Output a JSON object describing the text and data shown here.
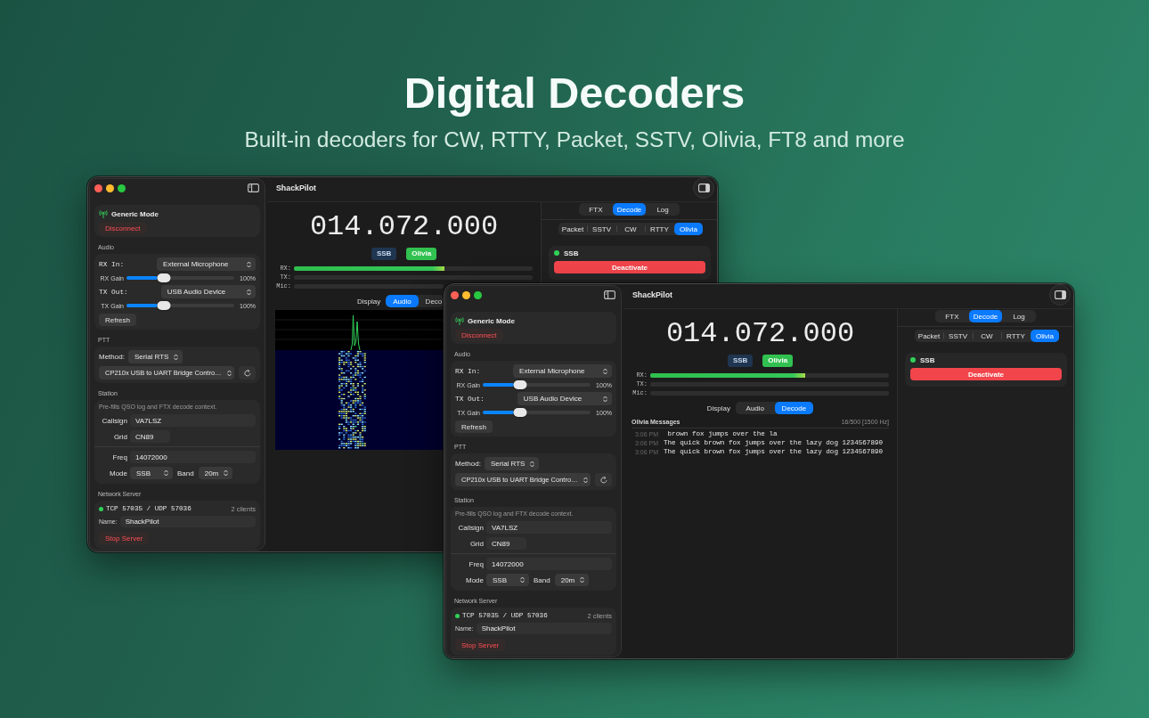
{
  "hero": {
    "title": "Digital Decoders",
    "subtitle": "Built-in decoders for CW, RTTY, Packet, SSTV, Olivia, FT8 and more"
  },
  "windows": [
    {
      "title": "ShackPilot",
      "sidebar": {
        "connection": {
          "mode": "Generic Mode",
          "button": "Disconnect"
        },
        "audio": {
          "heading": "Audio",
          "rows": [
            {
              "kind": "popup",
              "label": "RX In:",
              "value": "External Microphone"
            },
            {
              "kind": "slider",
              "label": "RX Gain",
              "level": 0.35,
              "reading": "100%"
            },
            {
              "kind": "popup",
              "label": "TX Out:",
              "value": "USB Audio Device"
            },
            {
              "kind": "slider",
              "label": "TX Gain",
              "level": 0.35,
              "reading": "100%"
            }
          ],
          "button": "Refresh"
        },
        "ptt": {
          "heading": "PTT",
          "method_label": "Method:",
          "method": "Serial RTS",
          "port": "CP210x USB to UART Bridge Contro…"
        },
        "station": {
          "heading": "Station",
          "note": "Pre-fills QSO log and FTX decode context.",
          "fields": [
            {
              "label": "Callsign",
              "value": "VA7LSZ"
            },
            {
              "label": "Grid",
              "value": "CN89"
            },
            {
              "label": "Freq",
              "value": "14072000"
            }
          ],
          "selects": [
            {
              "label": "Mode",
              "value": "SSB"
            },
            {
              "label": "Band",
              "value": "20m"
            }
          ]
        },
        "network": {
          "heading": "Network Server",
          "running": true,
          "status": "TCP 57035 / UDP 57036",
          "clients": "2 clients",
          "name_label": "Name:",
          "name": "ShackPilot",
          "button": "Stop Server"
        }
      },
      "main": {
        "frequency": "014.072.000",
        "badges": [
          {
            "kind": "mode",
            "label": "SSB"
          },
          {
            "kind": "decoder",
            "label": "Olivia"
          }
        ],
        "meters": [
          {
            "label": "RX:",
            "level": 0.63
          },
          {
            "label": "TX:",
            "level": 0
          },
          {
            "label": "Mic:",
            "level": 0
          }
        ],
        "view": {
          "label": "Display",
          "tabs": [
            {
              "label": "Audio",
              "selected": true
            },
            {
              "label": "Deco",
              "selected": false
            }
          ]
        },
        "display": {
          "kind": "waterfall"
        }
      },
      "panel": {
        "tabs": [
          {
            "label": "FTX",
            "selected": false
          },
          {
            "label": "Decode",
            "selected": true
          },
          {
            "label": "Log",
            "selected": false
          }
        ],
        "decoders": [
          {
            "label": "Packet",
            "selected": false
          },
          {
            "label": "SSTV",
            "selected": false
          },
          {
            "label": "CW",
            "selected": false
          },
          {
            "label": "RTTY",
            "selected": false
          },
          {
            "label": "Olivia",
            "selected": true
          }
        ],
        "status": {
          "active": true,
          "label": "SSB"
        },
        "button": "Deactivate"
      }
    },
    {
      "title": "ShackPilot",
      "sidebar": {
        "connection": {
          "mode": "Generic Mode",
          "button": "Disconnect"
        },
        "audio": {
          "heading": "Audio",
          "rows": [
            {
              "kind": "popup",
              "label": "RX In:",
              "value": "External Microphone"
            },
            {
              "kind": "slider",
              "label": "RX Gain",
              "level": 0.35,
              "reading": "100%"
            },
            {
              "kind": "popup",
              "label": "TX Out:",
              "value": "USB Audio Device"
            },
            {
              "kind": "slider",
              "label": "TX Gain",
              "level": 0.35,
              "reading": "100%"
            }
          ],
          "button": "Refresh"
        },
        "ptt": {
          "heading": "PTT",
          "method_label": "Method:",
          "method": "Serial RTS",
          "port": "CP210x USB to UART Bridge Contro…"
        },
        "station": {
          "heading": "Station",
          "note": "Pre-fills QSO log and FTX decode context.",
          "fields": [
            {
              "label": "Callsign",
              "value": "VA7LSZ"
            },
            {
              "label": "Grid",
              "value": "CN89"
            },
            {
              "label": "Freq",
              "value": "14072000"
            }
          ],
          "selects": [
            {
              "label": "Mode",
              "value": "SSB"
            },
            {
              "label": "Band",
              "value": "20m"
            }
          ]
        },
        "network": {
          "heading": "Network Server",
          "running": true,
          "status": "TCP 57035 / UDP 57036",
          "clients": "2 clients",
          "name_label": "Name:",
          "name": "ShackPilot",
          "button": "Stop Server"
        }
      },
      "main": {
        "frequency": "014.072.000",
        "badges": [
          {
            "kind": "mode",
            "label": "SSB"
          },
          {
            "kind": "decoder",
            "label": "Olivia"
          }
        ],
        "meters": [
          {
            "label": "RX:",
            "level": 0.65
          },
          {
            "label": "TX:",
            "level": 0
          },
          {
            "label": "Mic:",
            "level": 0
          }
        ],
        "view": {
          "label": "Display",
          "tabs": [
            {
              "label": "Audio",
              "selected": false
            },
            {
              "label": "Decode",
              "selected": true
            }
          ]
        },
        "display": {
          "kind": "messages",
          "title": "Olivia Messages",
          "stats": "16/500 [1500 Hz]",
          "rows": [
            {
              "time": "3:06 PM",
              "text": " brown fox jumps over the la"
            },
            {
              "time": "3:06 PM",
              "text": "The quick brown fox jumps over the lazy dog 1234567890"
            },
            {
              "time": "3:06 PM",
              "text": "The quick brown fox jumps over the lazy dog 1234567890"
            }
          ]
        }
      },
      "panel": {
        "tabs": [
          {
            "label": "FTX",
            "selected": false
          },
          {
            "label": "Decode",
            "selected": true
          },
          {
            "label": "Log",
            "selected": false
          }
        ],
        "decoders": [
          {
            "label": "Packet",
            "selected": false
          },
          {
            "label": "SSTV",
            "selected": false
          },
          {
            "label": "CW",
            "selected": false
          },
          {
            "label": "RTTY",
            "selected": false
          },
          {
            "label": "Olivia",
            "selected": true
          }
        ],
        "status": {
          "active": true,
          "label": "SSB"
        },
        "button": "Deactivate"
      }
    }
  ]
}
